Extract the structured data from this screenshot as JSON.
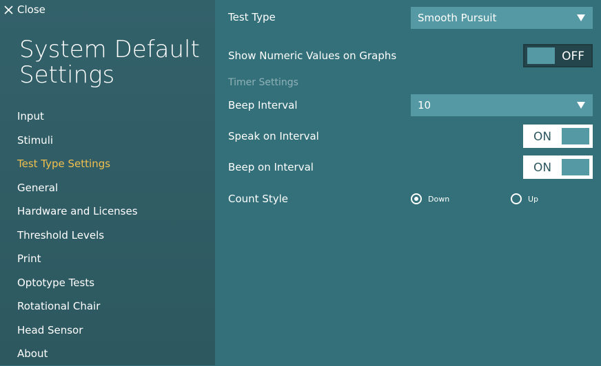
{
  "sidebar": {
    "close_label": "Close",
    "title_line1": "System Default",
    "title_line2": "Settings",
    "items": [
      {
        "label": "Input"
      },
      {
        "label": "Stimuli"
      },
      {
        "label": "Test Type Settings",
        "active": true
      },
      {
        "label": "General"
      },
      {
        "label": "Hardware and Licenses"
      },
      {
        "label": "Threshold Levels"
      },
      {
        "label": "Print"
      },
      {
        "label": "Optotype Tests"
      },
      {
        "label": "Rotational Chair"
      },
      {
        "label": "Head Sensor"
      },
      {
        "label": "About"
      }
    ]
  },
  "main": {
    "test_type": {
      "label": "Test Type",
      "value": "Smooth Pursuit"
    },
    "show_numeric": {
      "label": "Show Numeric Values on Graphs",
      "state": "OFF"
    },
    "timer_header": "Timer Settings",
    "beep_interval": {
      "label": "Beep Interval",
      "value": "10"
    },
    "speak_on_interval": {
      "label": "Speak on Interval",
      "state": "ON"
    },
    "beep_on_interval": {
      "label": "Beep on Interval",
      "state": "ON"
    },
    "count_style": {
      "label": "Count Style",
      "options": [
        {
          "label": "Down",
          "checked": true
        },
        {
          "label": "Up",
          "checked": false
        }
      ]
    }
  },
  "colors": {
    "main_bg": "#33707a",
    "sidebar_bg": "#2f5c64",
    "accent_active": "#f2c04e",
    "control_fill": "#5499a3"
  }
}
